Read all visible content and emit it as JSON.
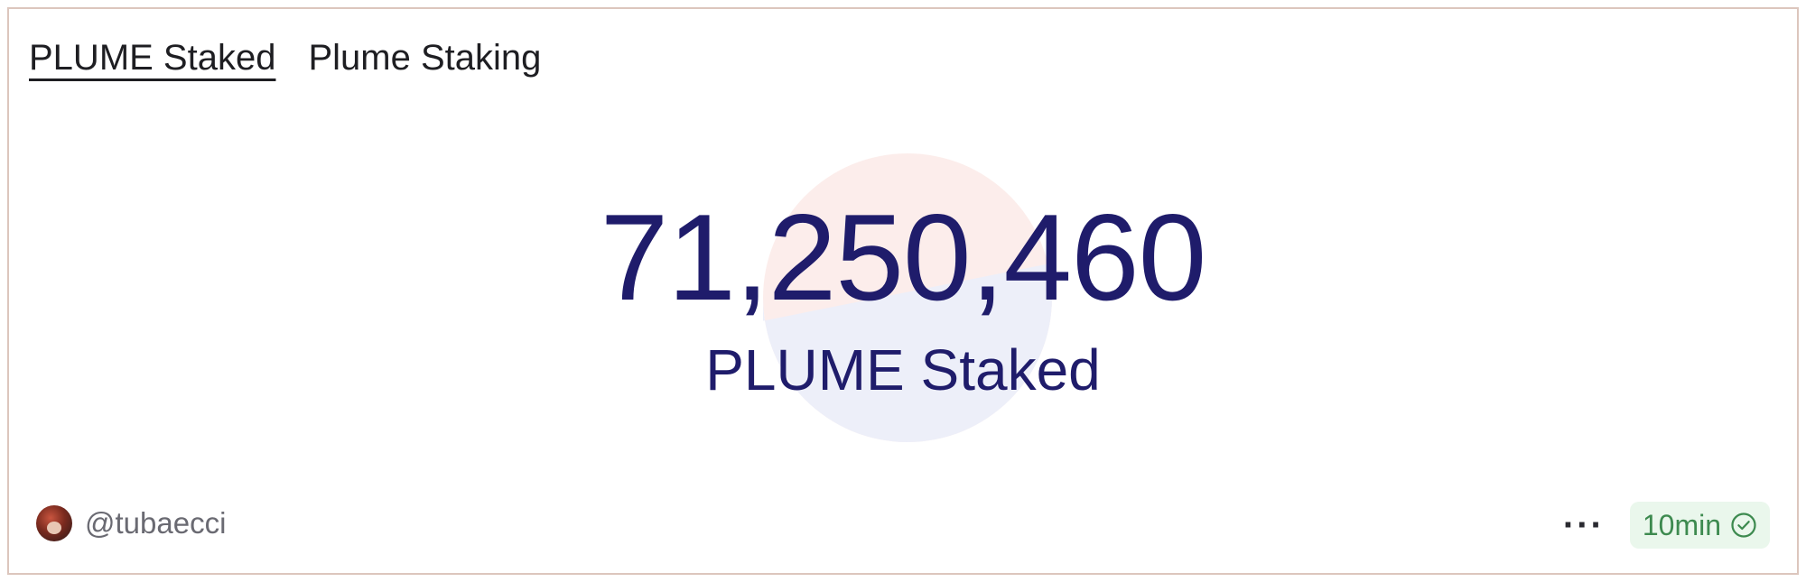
{
  "tabs": [
    {
      "label": "PLUME Staked",
      "active": true
    },
    {
      "label": "Plume Staking",
      "active": false
    }
  ],
  "counter": {
    "value": "71,250,460",
    "label": "PLUME Staked"
  },
  "footer": {
    "author": "@tubaecci",
    "more_label": "···",
    "refresh_interval": "10min"
  },
  "colors": {
    "value_text": "#1f1c6b",
    "badge_bg": "#eaf7ec",
    "badge_text": "#3d8a4f",
    "border": "#dcc6bd"
  },
  "icons": {
    "avatar": "user-avatar",
    "refresh_status": "check-circle-icon",
    "more": "more-dots-icon",
    "watermark": "dune-logo-watermark"
  }
}
